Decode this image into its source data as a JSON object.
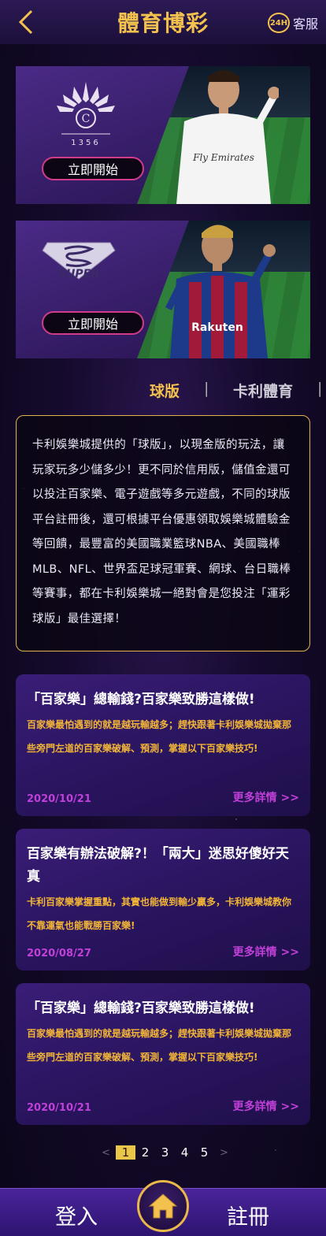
{
  "header": {
    "title": "體育博彩",
    "service_badge": "24H",
    "service_label": "客服"
  },
  "banners": [
    {
      "logo_text": "1356",
      "logo_letter": "C",
      "button_label": "立即開始",
      "jersey_text": "Fly Emirates"
    },
    {
      "logo_text": "SUPER",
      "button_label": "立即開始",
      "jersey_text": "Rakuten"
    }
  ],
  "tabs": {
    "active": "球版",
    "separator": "|",
    "other": "卡利體育"
  },
  "intro": {
    "text": "卡利娛樂城提供的「球版」，以現金版的玩法，讓玩家玩多少儲多少！更不同於信用版，儲值金還可以投注百家樂、電子遊戲等多元遊戲，不同的球版平台註冊後，還可根據平台優惠領取娛樂城體驗金等回饋，最豐富的美國職業籃球NBA、美國職棒MLB、NFL、世界盃足球冠軍賽、網球、台日職棒等賽事，都在卡利娛樂城一絕對會是您投注「運彩球版」最佳選擇！"
  },
  "articles": [
    {
      "title": "「百家樂」總輸錢?百家樂致勝這樣做!",
      "excerpt": "百家樂最怕遇到的就是越玩輸越多；趕快跟著卡利娛樂城拋棄那些旁門左道的百家樂破解、預測，掌握以下百家樂技巧!",
      "date": "2020/10/21",
      "more": "更多詳情 >>"
    },
    {
      "title": "百家樂有辦法破解?！「兩大」迷思好傻好天真",
      "excerpt": "卡利百家樂掌握重點，其實也能做到輸少贏多，卡利娛樂城教你不靠運氣也能戰勝百家樂!",
      "date": "2020/08/27",
      "more": "更多詳情 >>"
    },
    {
      "title": "「百家樂」總輸錢?百家樂致勝這樣做!",
      "excerpt": "百家樂最怕遇到的就是越玩輸越多；趕快跟著卡利娛樂城拋棄那些旁門左道的百家樂破解、預測，掌握以下百家樂技巧!",
      "date": "2020/10/21",
      "more": "更多詳情 >>"
    }
  ],
  "pagination": {
    "prev": "<",
    "pages": [
      "1",
      "2",
      "3",
      "4",
      "5"
    ],
    "current": "1",
    "next": ">"
  },
  "bottom_nav": {
    "login": "登入",
    "register": "註冊",
    "home_icon": "home-icon"
  },
  "colors": {
    "accent_gold": "#f2c14e",
    "excerpt_orange": "#f2b536",
    "link_purple": "#c040d8",
    "button_border_pink": "#d13b8a"
  }
}
